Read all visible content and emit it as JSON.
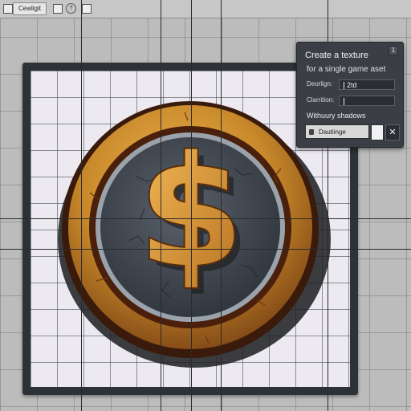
{
  "toolbar": {
    "mode_label": "Cewligit",
    "icon_name": "help-icon",
    "icon_glyph": "?"
  },
  "panel": {
    "title": "Create a texture",
    "subtitle": "for a single game aset",
    "close_glyph": "1",
    "rows": [
      {
        "label": "Deorlign:",
        "value": "2td"
      },
      {
        "label": "Clarrition:",
        "value": ""
      }
    ],
    "note": "Withuury shadows",
    "bottom_label": "Dautiinge",
    "close_button_glyph": "✕"
  },
  "asset": {
    "symbol": "$",
    "colors": {
      "rim_gold": "#c8892a",
      "rim_dark": "#4a1f0c",
      "face_stone": "#3e454d",
      "symbol_gold": "#e0a040"
    }
  }
}
